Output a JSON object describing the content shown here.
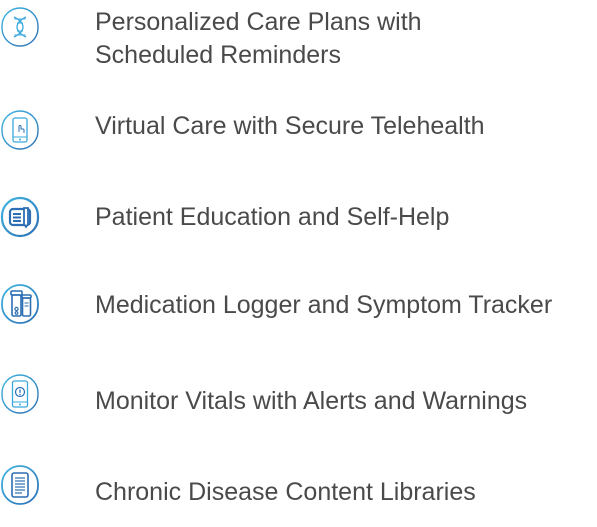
{
  "colors": {
    "icon_blue": "#29a8dc",
    "icon_navy": "#2c6fb4",
    "text": "#4a4a4a"
  },
  "features": [
    {
      "icon": "dna-helix-icon",
      "lines": [
        "Personalized Care Plans with",
        "Scheduled Reminders"
      ]
    },
    {
      "icon": "smartphone-touch-icon",
      "lines": [
        "Virtual Care with Secure Telehealth"
      ]
    },
    {
      "icon": "document-pen-icon",
      "lines": [
        "Patient Education and Self-Help"
      ]
    },
    {
      "icon": "medication-bottles-icon",
      "lines": [
        "Medication Logger and Symptom Tracker"
      ]
    },
    {
      "icon": "phone-alert-icon",
      "lines": [
        "Monitor Vitals with Alerts and Warnings"
      ]
    },
    {
      "icon": "document-library-icon",
      "lines": [
        "Chronic Disease Content Libraries"
      ]
    }
  ]
}
